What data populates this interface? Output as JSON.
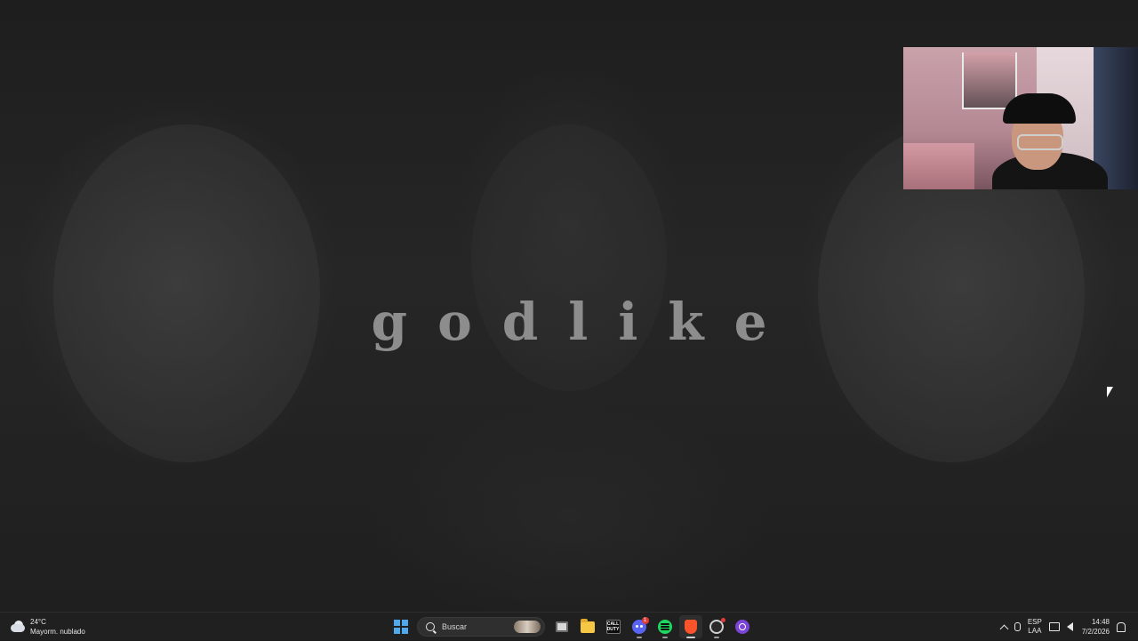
{
  "wallpaper": {
    "wordmark": "godlike"
  },
  "webcam": {
    "label": "webcam overlay"
  },
  "taskbar": {
    "weather": {
      "temperature": "24°C",
      "description": "Mayorm. nublado",
      "icon": "cloudy-icon"
    },
    "search": {
      "placeholder": "Buscar"
    },
    "pinned_apps": [
      {
        "name": "start",
        "icon": "windows-logo-icon"
      },
      {
        "name": "task-view",
        "icon": "task-view-icon"
      },
      {
        "name": "file-explorer",
        "icon": "folder-icon"
      },
      {
        "name": "call-of-duty",
        "icon": "game-icon",
        "label": "CALL DUTY"
      },
      {
        "name": "discord",
        "icon": "discord-icon",
        "badge": "1"
      },
      {
        "name": "spotify",
        "icon": "spotify-icon"
      },
      {
        "name": "brave",
        "icon": "brave-icon"
      },
      {
        "name": "obs",
        "icon": "obs-icon"
      },
      {
        "name": "app",
        "icon": "ring-app-icon"
      }
    ],
    "tray": {
      "language_top": "ESP",
      "language_bottom": "LAA",
      "time": "14:48",
      "date": "7/2/2026"
    }
  },
  "colors": {
    "taskbar_bg": "#202020",
    "accent": "#4fa9ec",
    "wordmark": "#8d8d8d"
  }
}
